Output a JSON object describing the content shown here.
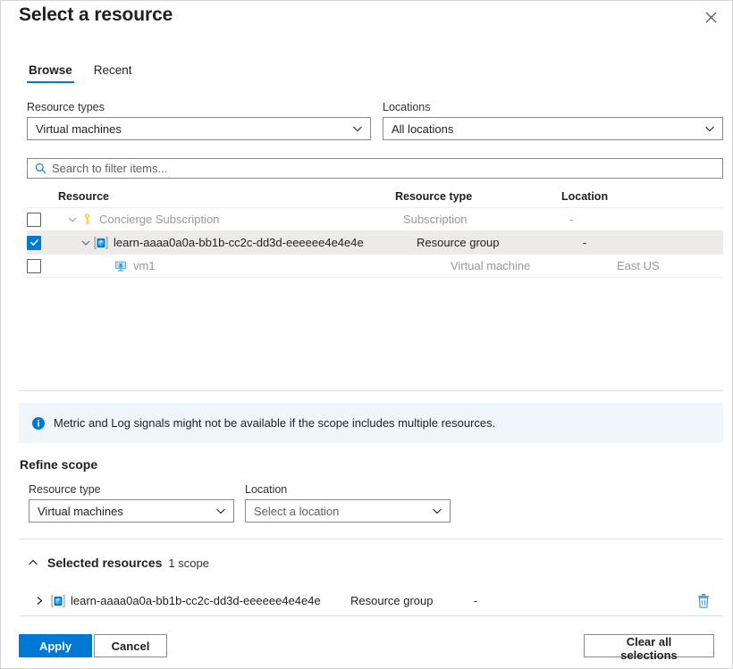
{
  "dialog": {
    "title": "Select a resource",
    "close_icon": "close-icon"
  },
  "tabs": [
    {
      "label": "Browse",
      "active": true
    },
    {
      "label": "Recent",
      "active": false
    }
  ],
  "filters": {
    "resource_types": {
      "label": "Resource types",
      "value": "Virtual machines"
    },
    "locations": {
      "label": "Locations",
      "value": "All locations"
    }
  },
  "search": {
    "placeholder": "Search to filter items...",
    "value": "",
    "icon": "search-icon"
  },
  "table": {
    "columns": [
      "Resource",
      "Resource type",
      "Location"
    ],
    "rows": [
      {
        "name": "Concierge Subscription",
        "type": "Subscription",
        "location": "-",
        "checked": false,
        "selected": false,
        "dim": true,
        "indent": 1,
        "expandable": true,
        "icon": "key-icon"
      },
      {
        "name": "learn-aaaa0a0a-bb1b-cc2c-dd3d-eeeeee4e4e4e",
        "type": "Resource group",
        "location": "-",
        "checked": true,
        "selected": true,
        "dim": false,
        "indent": 2,
        "expandable": true,
        "icon": "resource-group-icon"
      },
      {
        "name": "vm1",
        "type": "Virtual machine",
        "location": "East US",
        "checked": false,
        "selected": false,
        "dim": true,
        "indent": 3,
        "expandable": false,
        "icon": "virtual-machine-icon"
      }
    ]
  },
  "banner": {
    "icon": "info-icon",
    "text": "Metric and Log signals might not be available if the scope includes multiple resources."
  },
  "refine_scope": {
    "title": "Refine scope",
    "resource_type": {
      "label": "Resource type",
      "value": "Virtual machines",
      "is_placeholder": false
    },
    "location": {
      "label": "Location",
      "value": "Select a location",
      "is_placeholder": true
    }
  },
  "selected_resources": {
    "title": "Selected resources",
    "count_label": "1 scope",
    "row": {
      "name": "learn-aaaa0a0a-bb1b-cc2c-dd3d-eeeeee4e4e4e",
      "type": "Resource group",
      "location": "-",
      "icon": "resource-group-icon",
      "delete_icon": "trash-icon"
    }
  },
  "footer": {
    "apply_label": "Apply",
    "cancel_label": "Cancel",
    "clear_label": "Clear all selections"
  },
  "colors": {
    "accent": "#0078d4",
    "banner_bg": "#eff6fc",
    "selected_row_bg": "#edebe9",
    "key_icon": "#ffd24d",
    "trash_icon": "#4a9ae0"
  }
}
